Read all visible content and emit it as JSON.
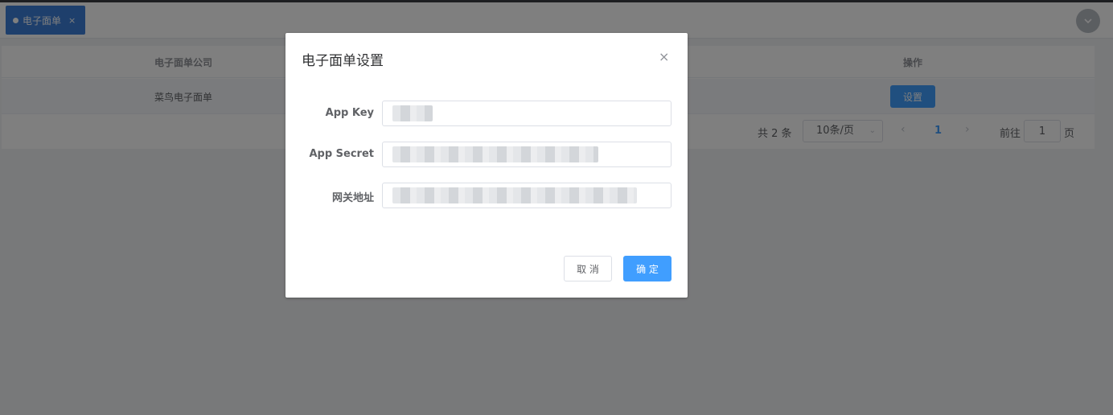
{
  "tabs": [
    {
      "label": "电子面单",
      "close_glyph": "×",
      "active": true
    }
  ],
  "tab_dropdown_icon": "chevron-down-icon",
  "table": {
    "columns": [
      "电子面单公司",
      "操作"
    ],
    "rows": [
      {
        "company": "菜鸟电子面单",
        "action_label": "设置"
      }
    ]
  },
  "pagination": {
    "total_text": "共 2 条",
    "page_size": "10条/页",
    "current_page": "1",
    "goto_label": "前往",
    "goto_value": "1",
    "page_suffix": "页"
  },
  "dialog": {
    "title": "电子面单设置",
    "close_glyph": "×",
    "fields": [
      {
        "label": "App Key",
        "value": ""
      },
      {
        "label": "App Secret",
        "value": ""
      },
      {
        "label": "网关地址",
        "value": ""
      }
    ],
    "cancel_label": "取 消",
    "confirm_label": "确 定"
  },
  "colors": {
    "primary": "#409eff",
    "tab_active": "#3d7fd9",
    "mask": "rgba(0,0,0,0.5)"
  }
}
